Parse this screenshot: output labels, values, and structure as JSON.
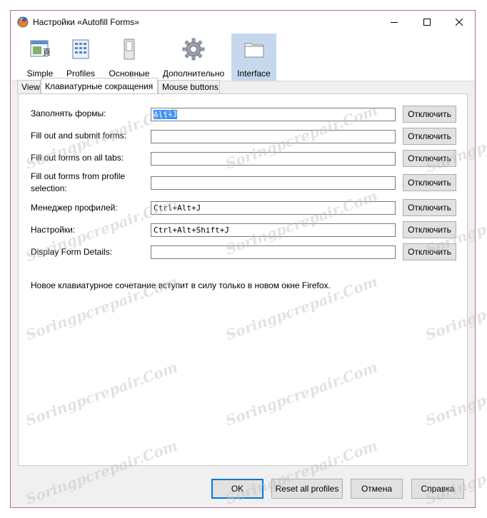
{
  "window": {
    "title": "Настройки «Autofill Forms»"
  },
  "toolbar": {
    "items": [
      {
        "label": "Simple",
        "icon": "simple-icon"
      },
      {
        "label": "Profiles",
        "icon": "profiles-icon"
      },
      {
        "label": "Основные",
        "icon": "main-switch-icon"
      },
      {
        "label": "Дополнительно",
        "icon": "gear-icon"
      },
      {
        "label": "Interface",
        "icon": "folder-icon",
        "selected": true
      }
    ]
  },
  "tabs": [
    {
      "label": "View"
    },
    {
      "label": "Клавиатурные сокращения",
      "active": true
    },
    {
      "label": "Mouse buttons"
    }
  ],
  "shortcuts": {
    "rows": [
      {
        "label": "Заполнять формы:",
        "value": "Alt+J",
        "button": "Отключить"
      },
      {
        "label": "Fill out and submit forms:",
        "value": "",
        "button": "Отключить"
      },
      {
        "label": "Fill out forms on all tabs:",
        "value": "",
        "button": "Отключить"
      },
      {
        "label_line1": "Fill out forms from profile",
        "label_line2": "selection:",
        "value": "",
        "button": "Отключить"
      },
      {
        "label": "Менеджер профилей:",
        "value": "Ctrl+Alt+J",
        "button": "Отключить"
      },
      {
        "label": "Настройки:",
        "value": "Ctrl+Alt+Shift+J",
        "button": "Отключить"
      },
      {
        "label": "Display Form Details:",
        "value": "",
        "button": "Отключить"
      }
    ],
    "note": "Новое клавиатурное сочетание вступит в силу только в новом окне Firefox."
  },
  "footer": {
    "ok": "OK",
    "reset": "Reset all profiles",
    "cancel": "Отмена",
    "help": "Справка"
  },
  "watermark": "Soringpcrepair.Com",
  "colors": {
    "accent": "#0078d7",
    "selection": "#3390ff",
    "selected_tool": "#c5d8ee"
  }
}
